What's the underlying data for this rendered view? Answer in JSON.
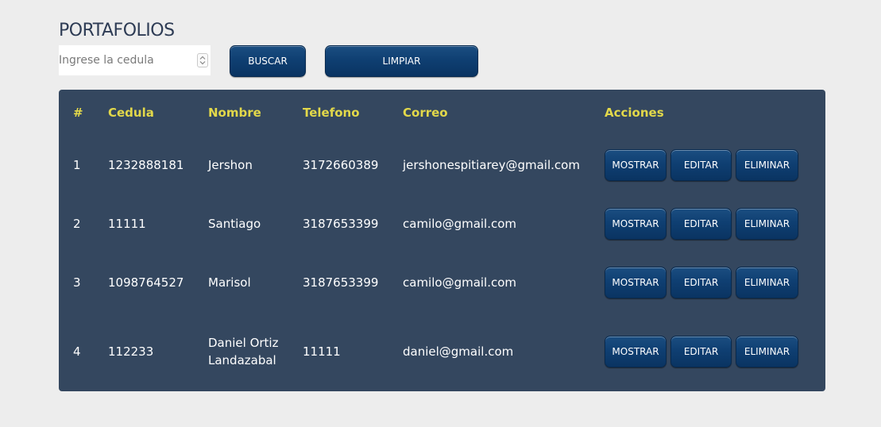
{
  "page": {
    "title": "PORTAFOLIOS"
  },
  "search": {
    "value": "",
    "placeholder": "Ingrese la cedula",
    "spinner_icon": "up-down-chevron-icon"
  },
  "toolbar": {
    "buscar_label": "BUSCAR",
    "limpiar_label": "LIMPIAR"
  },
  "colors": {
    "background": "#ededed",
    "table_bg": "#34475f",
    "header_text": "#e2d84a",
    "button": "#0f3f72",
    "title": "#2e3c55"
  },
  "table": {
    "headers": [
      "#",
      "Cedula",
      "Nombre",
      "Telefono",
      "Correo",
      "Acciones"
    ],
    "action_labels": {
      "show": "MOSTRAR",
      "edit": "EDITAR",
      "delete": "ELIMINAR"
    },
    "rows": [
      {
        "num": "1",
        "cedula": "1232888181",
        "nombre": "Jershon",
        "telefono": "3172660389",
        "correo": "jershonespitiarey@gmail.com"
      },
      {
        "num": "2",
        "cedula": "11111",
        "nombre": "Santiago",
        "telefono": "3187653399",
        "correo": "camilo@gmail.com"
      },
      {
        "num": "3",
        "cedula": "1098764527",
        "nombre": "Marisol",
        "telefono": "3187653399",
        "correo": "camilo@gmail.com"
      },
      {
        "num": "4",
        "cedula": "112233",
        "nombre": "Daniel Ortiz Landazabal",
        "telefono": "11111",
        "correo": "daniel@gmail.com"
      }
    ]
  }
}
